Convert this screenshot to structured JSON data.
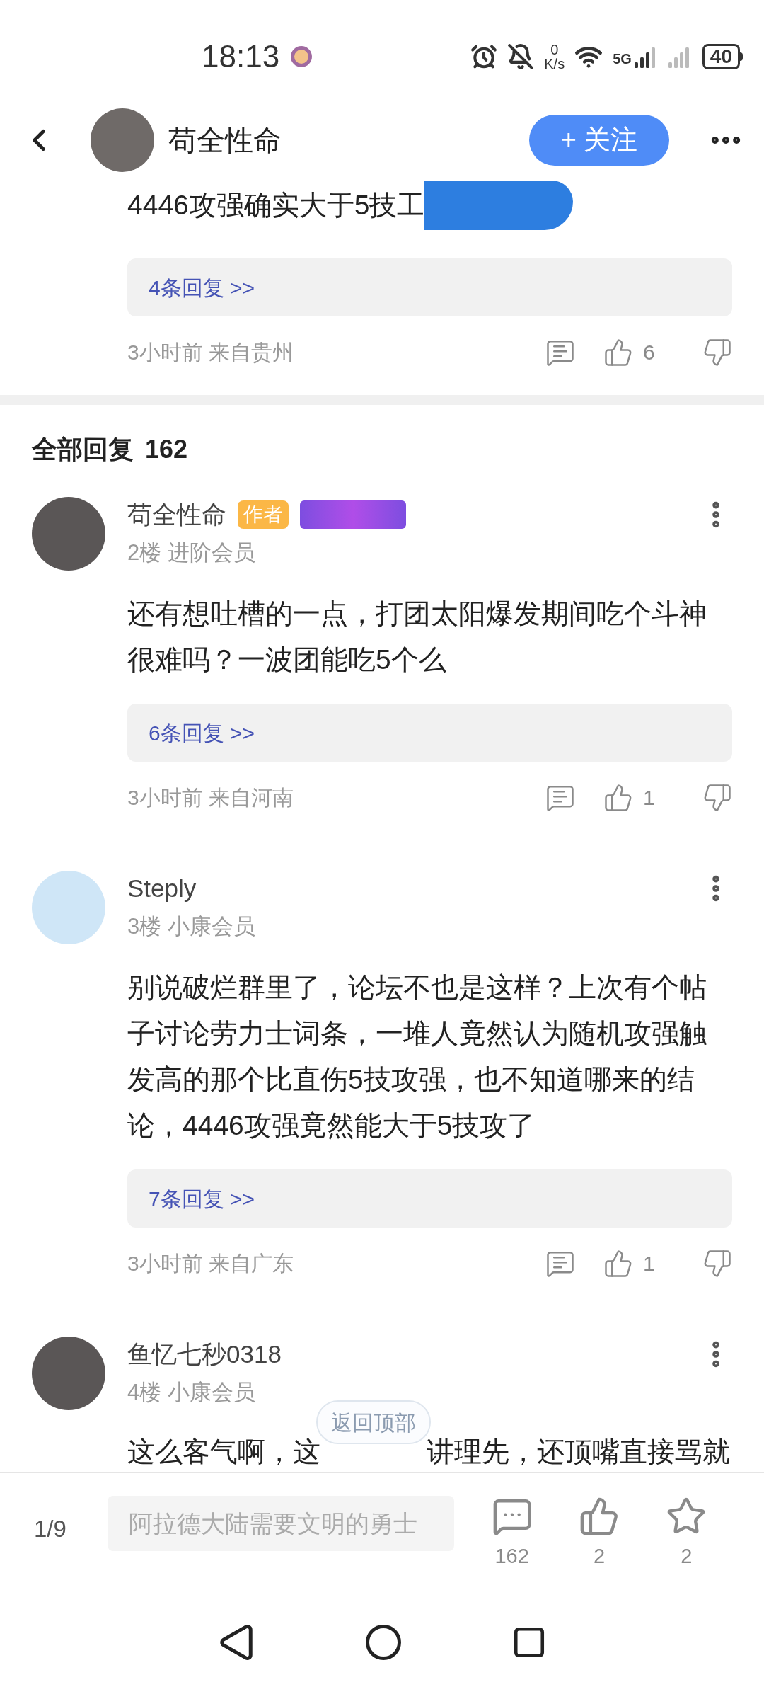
{
  "status_bar": {
    "time": "18:13",
    "net_speed_value": "0",
    "net_speed_unit": "K/s",
    "network": "5G",
    "battery": "40"
  },
  "header": {
    "author": "苟全性命",
    "follow_button": "+ 关注"
  },
  "top_comment": {
    "text": "4446攻强确实大于5技工",
    "replies": "4条回复 >>",
    "meta": "3小时前 来自贵州",
    "likes": "6"
  },
  "section": {
    "title": "全部回复",
    "count": "162"
  },
  "comments": [
    {
      "name": "苟全性命",
      "author_badge": "作者",
      "level_badge": true,
      "floor_info": "2楼 进阶会员",
      "text": "还有想吐槽的一点，打团太阳爆发期间吃个斗神很难吗？一波团能吃5个么",
      "replies": "6条回复 >>",
      "meta": "3小时前 来自河南",
      "likes": "1"
    },
    {
      "name": "Steply",
      "level_badge": false,
      "floor_info": "3楼 小康会员",
      "text": "别说破烂群里了，论坛不也是这样？上次有个帖子讨论劳力士词条，一堆人竟然认为随机攻强触发高的那个比直伤5技攻强，也不知道哪来的结论，4446攻强竟然能大于5技攻了",
      "replies": "7条回复 >>",
      "meta": "3小时前 来自广东",
      "likes": "1"
    },
    {
      "name": "鱼忆七秒0318",
      "level_badge": false,
      "floor_info": "4楼 小康会员",
      "text_before": "这么客气啊，这",
      "text_after": "讲理先，还顶嘴直接骂就"
    }
  ],
  "back_to_top": "返回顶部",
  "bottom_bar": {
    "page": "1/9",
    "placeholder": "阿拉德大陆需要文明的勇士",
    "comments": "162",
    "likes": "2",
    "favorites": "2"
  }
}
